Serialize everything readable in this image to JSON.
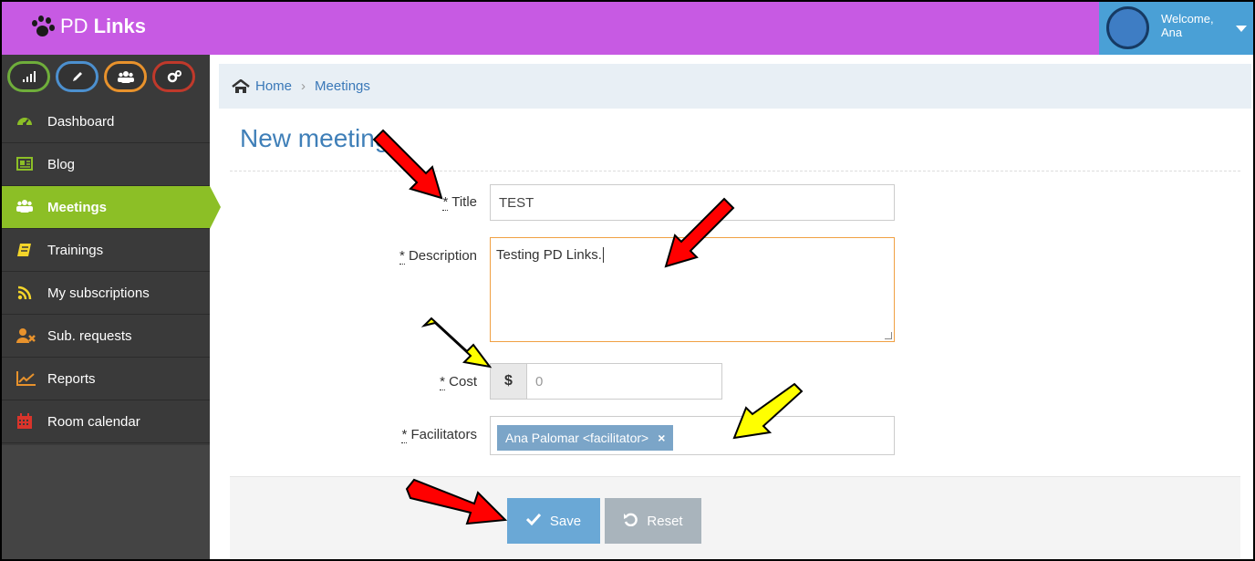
{
  "header": {
    "brand_prefix": "PD",
    "brand_name": "Links",
    "welcome": "Welcome,",
    "user_name": "Ana"
  },
  "sidebar": {
    "shortcuts": [
      {
        "icon": "signal-icon",
        "color": "#6fae3b"
      },
      {
        "icon": "pencil-icon",
        "color": "#4c90cf"
      },
      {
        "icon": "group-icon",
        "color": "#e8922c"
      },
      {
        "icon": "cogs-icon",
        "color": "#c0392b"
      }
    ],
    "items": [
      {
        "label": "Dashboard",
        "icon": "dashboard-icon",
        "color": "#8cbf26"
      },
      {
        "label": "Blog",
        "icon": "newspaper-icon",
        "color": "#8cbf26"
      },
      {
        "label": "Meetings",
        "icon": "group-icon",
        "color": "#ffffff",
        "active": true
      },
      {
        "label": "Trainings",
        "icon": "book-icon",
        "color": "#f3d52a"
      },
      {
        "label": "My subscriptions",
        "icon": "rss-icon",
        "color": "#f3d52a"
      },
      {
        "label": "Sub. requests",
        "icon": "user-remove-icon",
        "color": "#e8922c"
      },
      {
        "label": "Reports",
        "icon": "line-chart-icon",
        "color": "#e8922c"
      },
      {
        "label": "Room calendar",
        "icon": "calendar-icon",
        "color": "#d9342b"
      }
    ]
  },
  "breadcrumb": {
    "home": "Home",
    "separator": "›",
    "current": "Meetings"
  },
  "page": {
    "title": "New meeting"
  },
  "form": {
    "title_label": "Title",
    "title_value": "TEST",
    "description_label": "Description",
    "description_value": "Testing PD Links.",
    "cost_label": "Cost",
    "cost_currency": "$",
    "cost_placeholder": "0",
    "facilitators_label": "Facilitators",
    "facilitator_tag": "Ana Palomar <facilitator>",
    "tag_remove": "×",
    "required_mark": "*"
  },
  "actions": {
    "save": "Save",
    "reset": "Reset"
  },
  "colors": {
    "header": "#c75ae3",
    "user_box": "#4aa0d6",
    "active_nav": "#8cbf26",
    "accent_blue": "#3f7fb8",
    "arrow_red": "#ff0000",
    "arrow_yellow": "#ffff00"
  }
}
